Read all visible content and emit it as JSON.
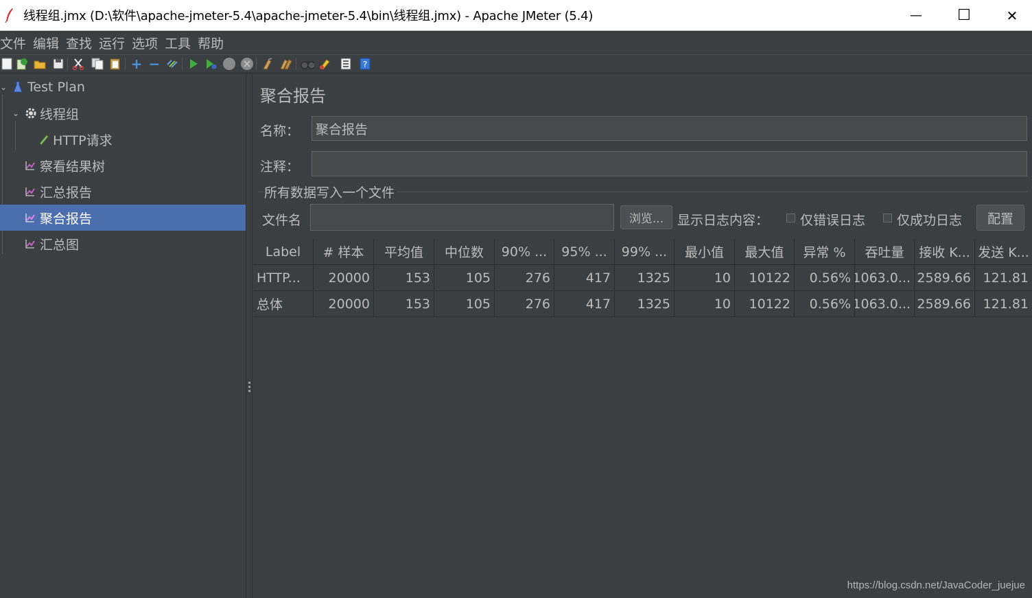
{
  "window": {
    "title": "线程组.jmx (D:\\软件\\apache-jmeter-5.4\\apache-jmeter-5.4\\bin\\线程组.jmx) - Apache JMeter (5.4)",
    "minimize": "—",
    "maximize": "☐",
    "close": "✕"
  },
  "menu": [
    "文件",
    "编辑",
    "查找",
    "运行",
    "选项",
    "工具",
    "帮助"
  ],
  "tree": {
    "items": [
      {
        "label": "Test Plan"
      },
      {
        "label": "线程组"
      },
      {
        "label": "HTTP请求"
      },
      {
        "label": "察看结果树"
      },
      {
        "label": "汇总报告"
      },
      {
        "label": "聚合报告"
      },
      {
        "label": "汇总图"
      }
    ],
    "selected": "聚合报告"
  },
  "panel": {
    "title": "聚合报告",
    "name_label": "名称：",
    "name_value": "聚合报告",
    "comment_label": "注释：",
    "comment_value": "",
    "group_title": "所有数据写入一个文件",
    "filename_label": "文件名",
    "filename_value": "",
    "browse_button": "浏览...",
    "log_label": "显示日志内容：",
    "errors_only": "仅错误日志",
    "success_only": "仅成功日志",
    "config_button": "配置"
  },
  "table": {
    "headers": [
      "Label",
      "# 样本",
      "平均值",
      "中位数",
      "90% ...",
      "95% ...",
      "99% ...",
      "最小值",
      "最大值",
      "异常 %",
      "吞吐量",
      "接收 K...",
      "发送 K..."
    ],
    "rows": [
      [
        "HTTP...",
        "20000",
        "153",
        "105",
        "276",
        "417",
        "1325",
        "10",
        "10122",
        "0.56%",
        "1063.0...",
        "2589.66",
        "121.81"
      ],
      [
        "总体",
        "20000",
        "153",
        "105",
        "276",
        "417",
        "1325",
        "10",
        "10122",
        "0.56%",
        "1063.0...",
        "2589.66",
        "121.81"
      ]
    ]
  },
  "watermark": "https://blog.csdn.net/JavaCoder_juejue"
}
